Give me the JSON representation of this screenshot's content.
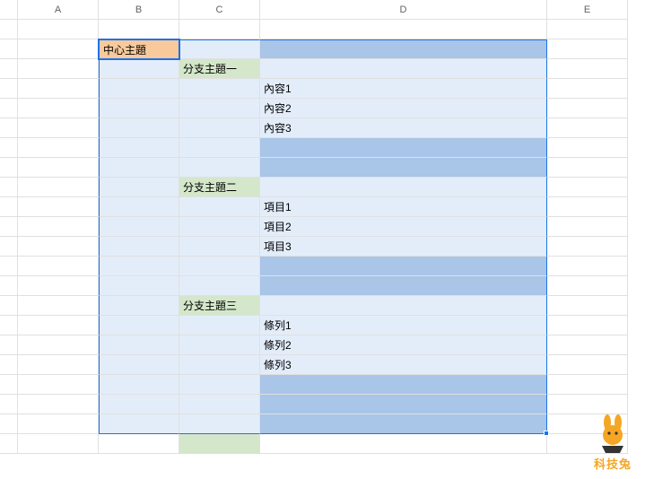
{
  "columns": [
    "A",
    "B",
    "C",
    "D",
    "E"
  ],
  "outline": {
    "central": "中心主題",
    "branches": [
      {
        "title": "分支主題一",
        "items": [
          "內容1",
          "內容2",
          "內容3"
        ]
      },
      {
        "title": "分支主題二",
        "items": [
          "項目1",
          "項目2",
          "項目3"
        ]
      },
      {
        "title": "分支主題三",
        "items": [
          "條列1",
          "條列2",
          "條列3"
        ]
      }
    ]
  },
  "logo_text": "科技兔"
}
